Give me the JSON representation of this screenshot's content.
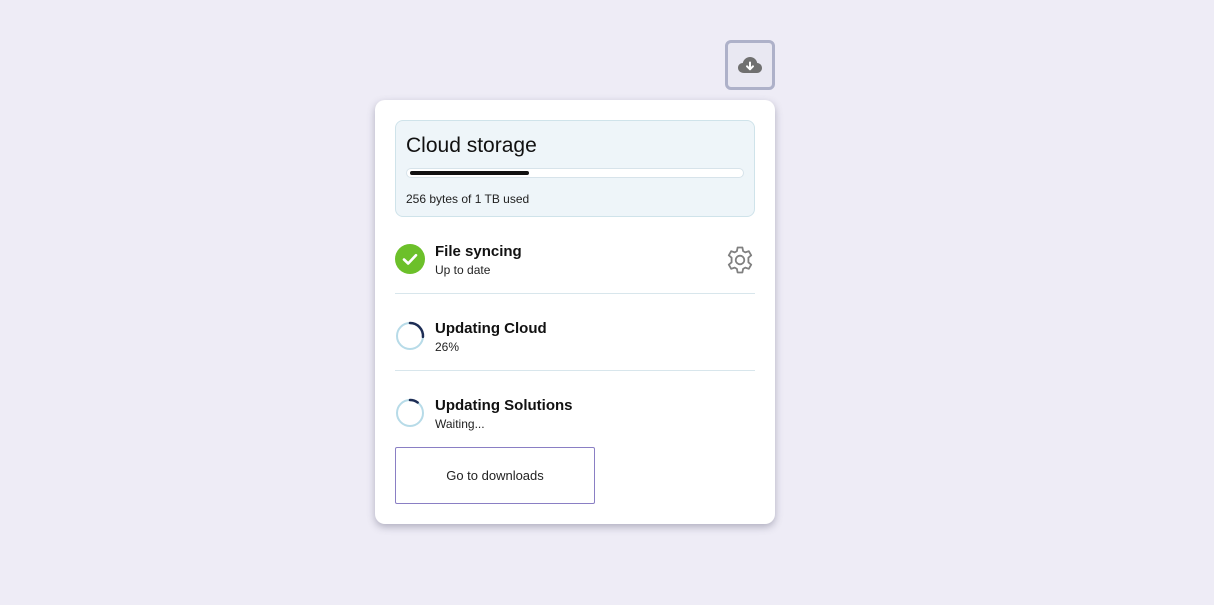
{
  "header": {
    "cloud_button_icon": "cloud-download-icon"
  },
  "storage": {
    "title": "Cloud storage",
    "usage_text": "256 bytes of 1 TB used",
    "bar_fill_fraction": 0.36
  },
  "sync": {
    "title": "File syncing",
    "status": "Up to date",
    "status_icon": "check-circle-icon",
    "settings_icon": "gear-icon"
  },
  "tasks": [
    {
      "title": "Updating Cloud",
      "status": "26%",
      "progress_fraction": 0.26
    },
    {
      "title": "Updating Solutions",
      "status": "Waiting...",
      "progress_fraction": 0.1
    }
  ],
  "actions": {
    "downloads_label": "Go to downloads"
  },
  "colors": {
    "background": "#eeecf6",
    "success": "#6cc02a",
    "spinner_track": "#b7dbe8",
    "spinner_arc": "#1d2d55",
    "button_border": "#8a7fc4"
  }
}
